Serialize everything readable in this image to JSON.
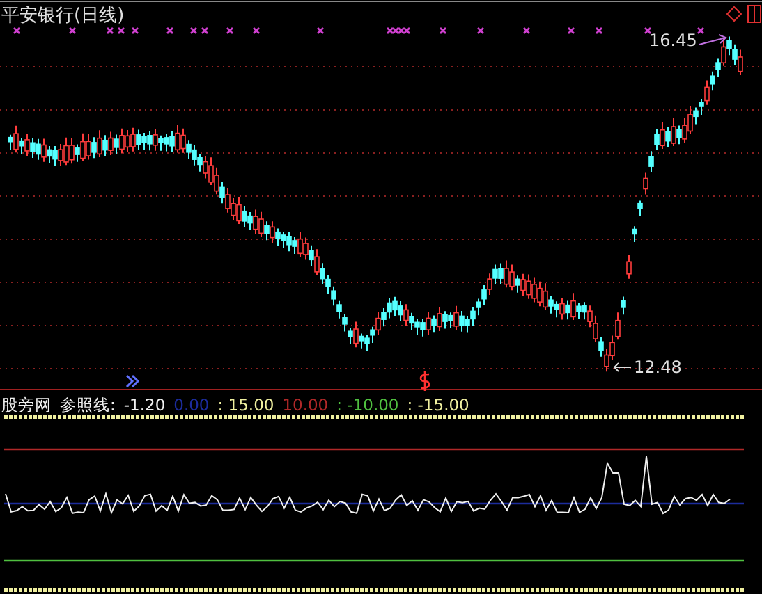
{
  "title": "平安银行(日线)",
  "price_labels": [
    {
      "kind": "high",
      "text": "16.45"
    },
    {
      "kind": "low",
      "text": "12.48"
    }
  ],
  "indicator": {
    "name": "股旁网",
    "label": "参照线:",
    "value": "-1.20",
    "levels": [
      {
        "text": "0.00",
        "color": "#1c2c9c"
      },
      {
        "text": ": 15.00",
        "color": "#f0f0a0"
      },
      {
        "text": "10.00",
        "color": "#b02828"
      },
      {
        "text": ": -10.00",
        "color": "#50c040"
      },
      {
        "text": ": -15.00",
        "color": "#f0f0a0"
      }
    ]
  }
}
